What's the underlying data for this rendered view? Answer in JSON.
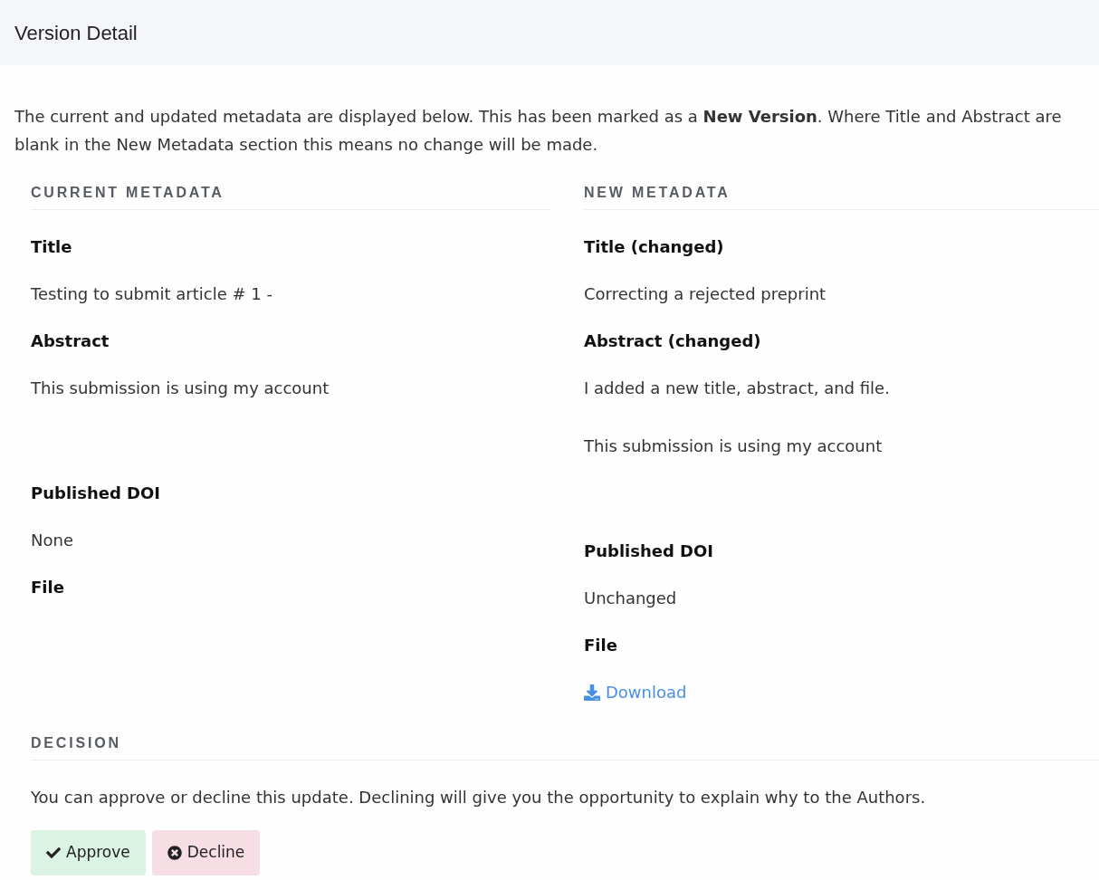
{
  "header": {
    "title": "Version Detail"
  },
  "intro": "The current and updated metadata are displayed below. This has been marked as a **New Version**. Where Title and Abstract are blank in the New Metadata section this means no change will be made.",
  "columns": [
    {
      "heading": "CURRENT METADATA",
      "fields": [
        {
          "kind": "text",
          "label": "Title",
          "value": "Testing to submit article # 1 -"
        },
        {
          "kind": "abstract",
          "label": "Abstract",
          "paragraphs": [
            "This submission is using my account"
          ]
        },
        {
          "kind": "text",
          "label": "Published DOI",
          "value": "None"
        },
        {
          "kind": "file",
          "label": "File"
        }
      ]
    },
    {
      "heading": "NEW METADATA",
      "fields": [
        {
          "kind": "text",
          "label": "Title (changed)",
          "value": "Correcting a rejected preprint"
        },
        {
          "kind": "abstract",
          "label": "Abstract (changed)",
          "paragraphs": [
            "I added a new title, abstract, and file.",
            "This submission is using my account"
          ]
        },
        {
          "kind": "text",
          "label": "Published DOI",
          "value": "Unchanged"
        },
        {
          "kind": "file",
          "label": "File",
          "link": "Download"
        }
      ]
    }
  ],
  "decision": {
    "heading": "DECISION",
    "text": "You can approve or decline this update. Declining will give you the opportunity to explain why to the Authors.",
    "buttons": [
      {
        "kind": "approve",
        "label": "Approve"
      },
      {
        "kind": "decline",
        "label": "Decline"
      }
    ]
  }
}
